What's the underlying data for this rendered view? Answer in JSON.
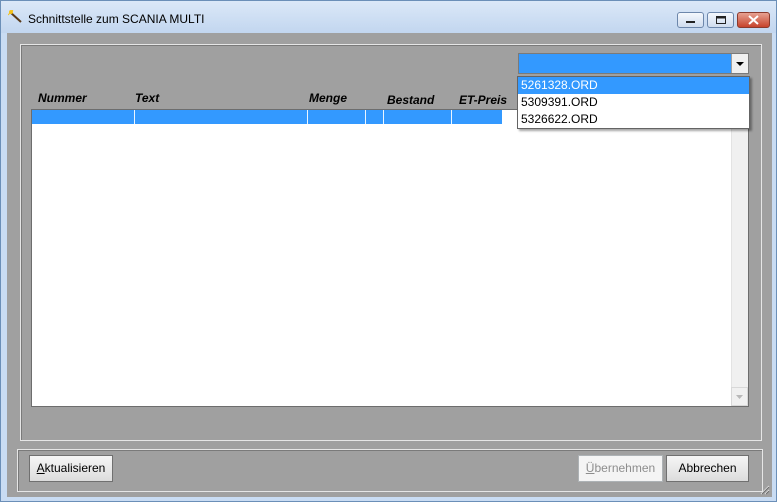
{
  "window": {
    "title": "Schnittstelle zum SCANIA MULTI",
    "buttons": {
      "minimize": "minimize-icon",
      "maximize": "maximize-icon",
      "close": "close-icon"
    }
  },
  "list": {
    "columns": [
      "Nummer",
      "Text",
      "Menge",
      "Bestand",
      "ET-Preis"
    ],
    "rows": [
      {
        "selected": true,
        "cells": [
          "",
          "",
          "",
          "",
          ""
        ]
      }
    ]
  },
  "combo": {
    "selected": "",
    "options": [
      "5261328.ORD",
      "5309391.ORD",
      "5326622.ORD"
    ],
    "highlighted_index": 0
  },
  "buttons": {
    "refresh_first": "A",
    "refresh_rest": "ktualisieren",
    "apply_first": "Ü",
    "apply_rest": "bernehmen",
    "cancel": "Abbrechen"
  },
  "colors": {
    "selection": "#3399ff",
    "client_bg": "#a0a0a0"
  }
}
